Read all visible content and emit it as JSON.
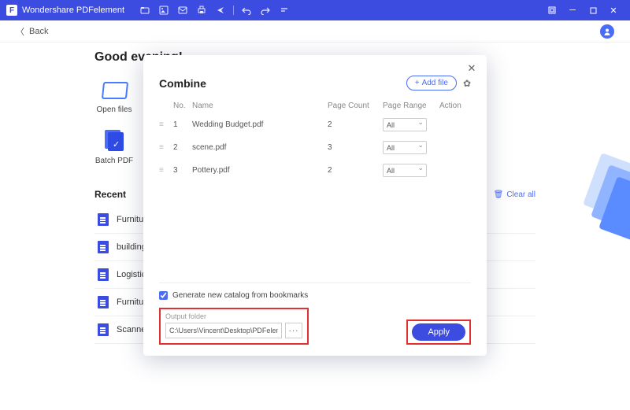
{
  "titlebar": {
    "app_name": "Wondershare PDFelement"
  },
  "subbar": {
    "back_label": "Back"
  },
  "greeting": "Good evening!",
  "features": {
    "open_files": "Open files",
    "batch_pdf": "Batch PDF"
  },
  "recent": {
    "title": "Recent",
    "clear_all": "Clear all",
    "items": [
      "Furniture",
      "building",
      "Logistics",
      "Furniture",
      "Scanned"
    ]
  },
  "modal": {
    "title": "Combine",
    "add_file": "Add file",
    "columns": {
      "no": "No.",
      "name": "Name",
      "page_count": "Page Count",
      "page_range": "Page Range",
      "action": "Action"
    },
    "rows": [
      {
        "no": "1",
        "name": "Wedding Budget.pdf",
        "page_count": "2",
        "range": "All"
      },
      {
        "no": "2",
        "name": "scene.pdf",
        "page_count": "3",
        "range": "All"
      },
      {
        "no": "3",
        "name": "Pottery.pdf",
        "page_count": "2",
        "range": "All"
      }
    ],
    "generate_label": "Generate new catalog from bookmarks",
    "output_label": "Output folder",
    "output_path": "C:\\Users\\Vincent\\Desktop\\PDFelement\\Cor",
    "apply": "Apply"
  }
}
